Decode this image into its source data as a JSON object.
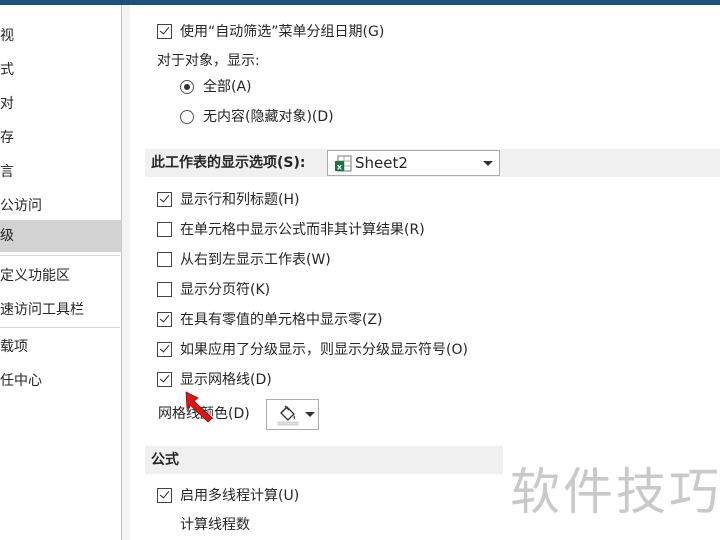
{
  "nav": {
    "items": [
      {
        "label": "视"
      },
      {
        "label": "式"
      },
      {
        "label": "对"
      },
      {
        "label": "存"
      },
      {
        "label": "言"
      },
      {
        "label": "公访问"
      },
      {
        "label": "级"
      },
      {
        "label": "定义功能区"
      },
      {
        "label": "速访问工具栏"
      },
      {
        "label": "载项"
      },
      {
        "label": "任中心"
      }
    ],
    "selected_index": 6
  },
  "options": {
    "group_dates": {
      "label": "使用“自动筛选”菜单分组日期(G)",
      "checked": true
    },
    "for_objects_label": "对于对象，显示:",
    "show_all": {
      "label": "全部(A)",
      "checked": true
    },
    "show_nothing": {
      "label": "无内容(隐藏对象)(D)",
      "checked": false
    }
  },
  "worksheet_section": {
    "header": "此工作表的显示选项(S):",
    "sheet_select_value": "Sheet2",
    "checkboxes": [
      {
        "label": "显示行和列标题(H)",
        "checked": true
      },
      {
        "label": "在单元格中显示公式而非其计算结果(R)",
        "checked": false
      },
      {
        "label": "从右到左显示工作表(W)",
        "checked": false
      },
      {
        "label": "显示分页符(K)",
        "checked": false
      },
      {
        "label": "在具有零值的单元格中显示零(Z)",
        "checked": true
      },
      {
        "label": "如果应用了分级显示，则显示分级显示符号(O)",
        "checked": true
      },
      {
        "label": "显示网格线(D)",
        "checked": true
      }
    ],
    "gridline_color_label": "网格线颜色(D)"
  },
  "formula_section": {
    "header": "公式",
    "multithread": {
      "label": "启用多线程计算(U)",
      "checked": true
    },
    "thread_count_label": "计算线程数"
  },
  "watermark": "软件技巧",
  "colors": {
    "accent": "#1f4e79",
    "arrow": "#d11a1a",
    "excel_green": "#1e7145"
  }
}
